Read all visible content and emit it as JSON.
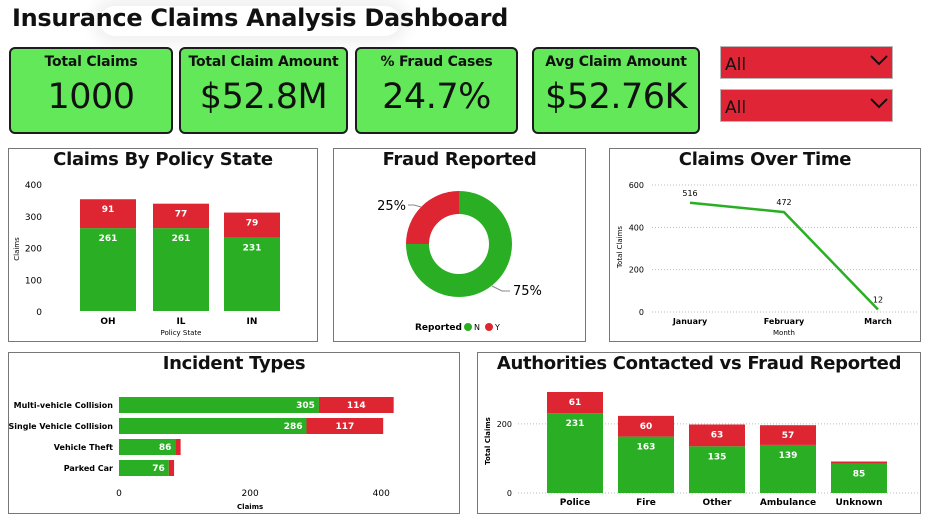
{
  "header": {
    "title": "Insurance Claims Analysis Dashboard"
  },
  "kpis": [
    {
      "label": "Total Claims",
      "value": "1000"
    },
    {
      "label": "Total Claim Amount",
      "value": "$52.8M"
    },
    {
      "label": "% Fraud Cases",
      "value": "24.7%"
    },
    {
      "label": "Avg Claim Amount",
      "value": "$52.76K"
    }
  ],
  "slicers": [
    {
      "value": "All"
    },
    {
      "value": "All"
    }
  ],
  "colors": {
    "kpi_bg": "#63e85a",
    "green": "#2aaf24",
    "red": "#de2532",
    "slicer_bg": "#e02636"
  },
  "chart_data": [
    {
      "id": "policy_state",
      "type": "bar",
      "stacked": true,
      "title": "Claims By Policy State",
      "xlabel": "Policy State",
      "ylabel": "Claims",
      "categories": [
        "OH",
        "IL",
        "IN"
      ],
      "series": [
        {
          "name": "N",
          "values": [
            261,
            261,
            231
          ]
        },
        {
          "name": "Y",
          "values": [
            91,
            77,
            79
          ]
        }
      ],
      "yticks": [
        "0",
        "100",
        "200",
        "300",
        "400"
      ],
      "ylim": [
        0,
        400
      ]
    },
    {
      "id": "fraud_reported",
      "type": "pie",
      "donut": true,
      "title": "Fraud Reported",
      "slices": [
        {
          "name": "N",
          "value": 75,
          "label": "75%"
        },
        {
          "name": "Y",
          "value": 25,
          "label": "25%"
        }
      ],
      "legend": {
        "title": "Reported",
        "items": [
          "N",
          "Y"
        ],
        "position": "bottom"
      }
    },
    {
      "id": "claims_over_time",
      "type": "line",
      "title": "Claims Over Time",
      "xlabel": "Month",
      "ylabel": "Total Claims",
      "categories": [
        "January",
        "February",
        "March"
      ],
      "values": [
        516,
        472,
        12
      ],
      "yticks": [
        "0",
        "200",
        "400",
        "600"
      ],
      "ylim": [
        0,
        600
      ],
      "grid": true
    },
    {
      "id": "incident_types",
      "type": "bar",
      "orientation": "horizontal",
      "stacked": true,
      "title": "Incident Types",
      "xlabel": "Claims",
      "categories": [
        "Multi-vehicle Collision",
        "Single Vehicle Collision",
        "Vehicle Theft",
        "Parked Car"
      ],
      "series": [
        {
          "name": "N",
          "values": [
            305,
            286,
            86,
            76
          ]
        },
        {
          "name": "Y",
          "values": [
            114,
            117,
            8,
            8
          ]
        }
      ],
      "xticks": [
        "0",
        "200",
        "400"
      ],
      "xlim": [
        0,
        450
      ]
    },
    {
      "id": "authorities",
      "type": "bar",
      "stacked": true,
      "title": "Authorities Contacted vs Fraud Reported",
      "ylabel": "Total Claims",
      "categories": [
        "Police",
        "Fire",
        "Other",
        "Ambulance",
        "Unknown"
      ],
      "series": [
        {
          "name": "N",
          "values": [
            231,
            163,
            135,
            139,
            85
          ]
        },
        {
          "name": "Y",
          "values": [
            61,
            60,
            63,
            57,
            6
          ]
        }
      ],
      "yticks": [
        "0",
        "200"
      ],
      "ylim": [
        0,
        292
      ]
    }
  ]
}
